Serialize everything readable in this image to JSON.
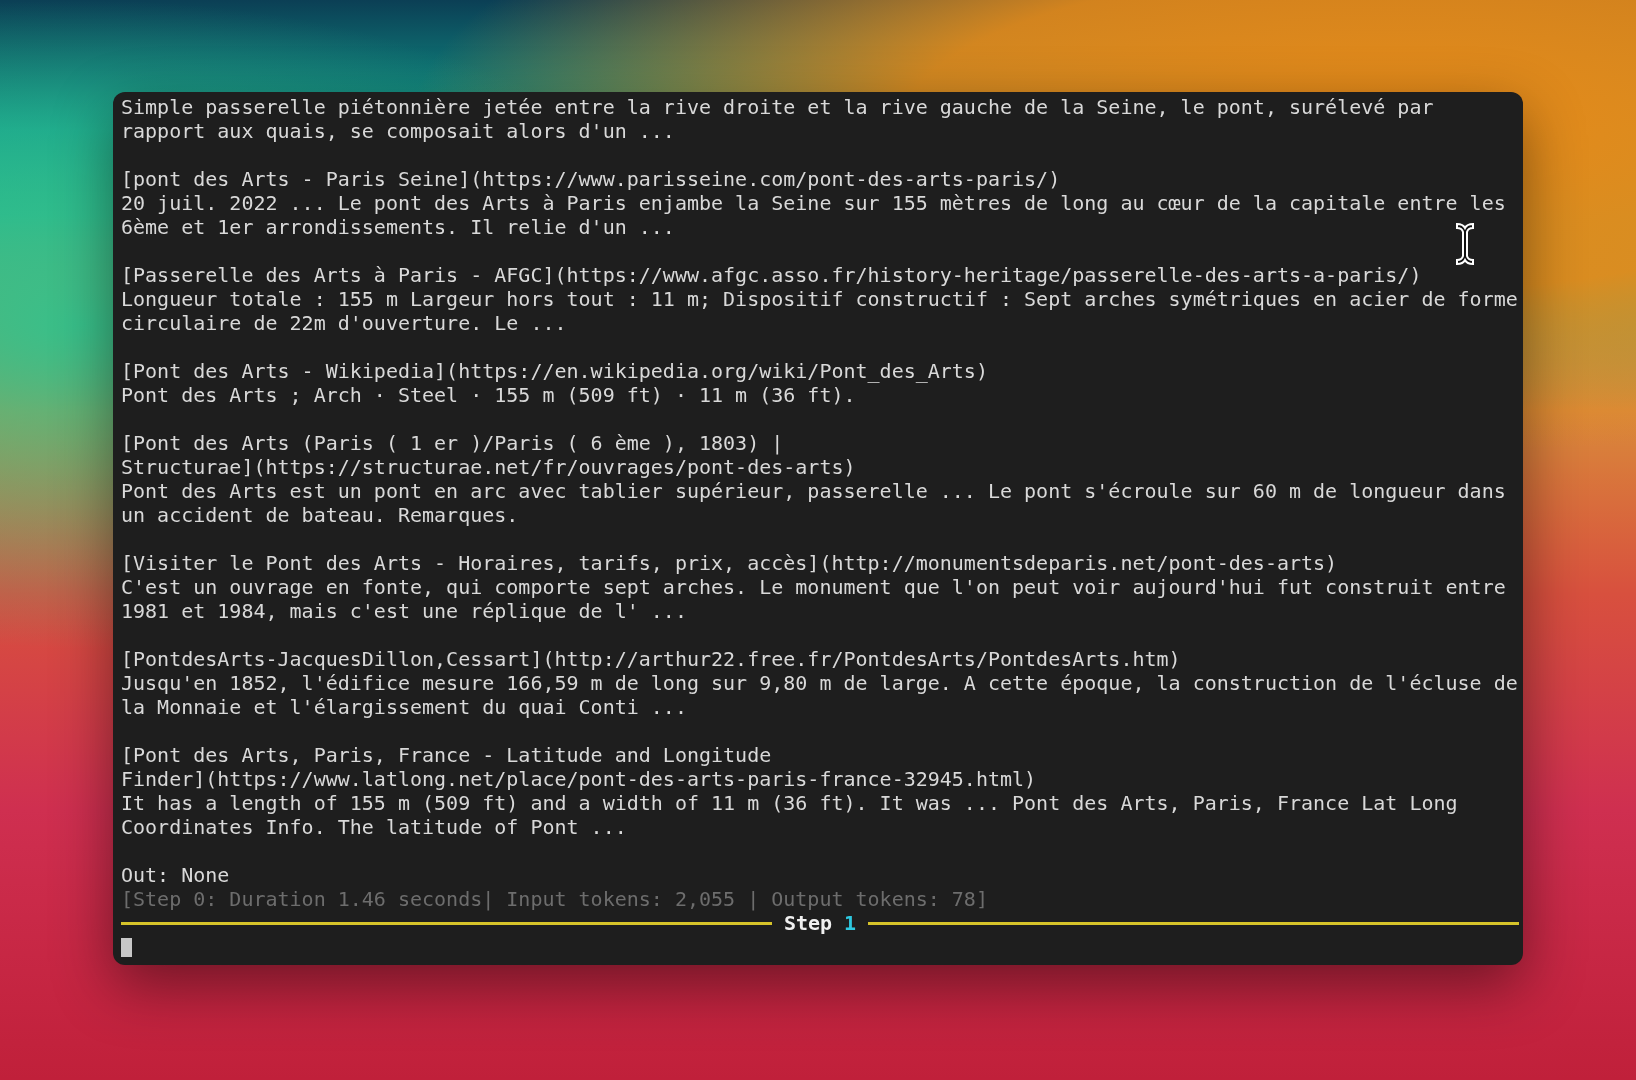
{
  "terminal": {
    "lines": [
      {
        "kind": "text",
        "text": "Simple passerelle piétonnière jetée entre la rive droite et la rive gauche de la Seine, le pont, surélevé par"
      },
      {
        "kind": "text",
        "text": "rapport aux quais, se composait alors d'un ..."
      },
      {
        "kind": "blank"
      },
      {
        "kind": "text",
        "text": "[pont des Arts - Paris Seine](https://www.parisseine.com/pont-des-arts-paris/)"
      },
      {
        "kind": "text",
        "text": "20 juil. 2022 ... Le pont des Arts à Paris enjambe la Seine sur 155 mètres de long au cœur de la capitale entre les"
      },
      {
        "kind": "text",
        "text": "6ème et 1er arrondissements. Il relie d'un ..."
      },
      {
        "kind": "blank"
      },
      {
        "kind": "text",
        "text": "[Passerelle des Arts à Paris - AFGC](https://www.afgc.asso.fr/history-heritage/passerelle-des-arts-a-paris/)"
      },
      {
        "kind": "text",
        "text": "Longueur totale : 155 m Largeur hors tout : 11 m; Dispositif constructif : Sept arches symétriques en acier de forme"
      },
      {
        "kind": "text",
        "text": "circulaire de 22m d'ouverture. Le ..."
      },
      {
        "kind": "blank"
      },
      {
        "kind": "text",
        "text": "[Pont des Arts - Wikipedia](https://en.wikipedia.org/wiki/Pont_des_Arts)"
      },
      {
        "kind": "text",
        "text": "Pont des Arts ; Arch · Steel · 155 m (509 ft) · 11 m (36 ft)."
      },
      {
        "kind": "blank"
      },
      {
        "kind": "text",
        "text": "[Pont des Arts (Paris ( 1 er )/Paris ( 6 ème ), 1803) |"
      },
      {
        "kind": "text",
        "text": "Structurae](https://structurae.net/fr/ouvrages/pont-des-arts)"
      },
      {
        "kind": "text",
        "text": "Pont des Arts est un pont en arc avec tablier supérieur, passerelle ... Le pont s'écroule sur 60 m de longueur dans"
      },
      {
        "kind": "text",
        "text": "un accident de bateau. Remarques."
      },
      {
        "kind": "blank"
      },
      {
        "kind": "text",
        "text": "[Visiter le Pont des Arts - Horaires, tarifs, prix, accès](http://monumentsdeparis.net/pont-des-arts)"
      },
      {
        "kind": "text",
        "text": "C'est un ouvrage en fonte, qui comporte sept arches. Le monument que l'on peut voir aujourd'hui fut construit entre"
      },
      {
        "kind": "text",
        "text": "1981 et 1984, mais c'est une réplique de l' ..."
      },
      {
        "kind": "blank"
      },
      {
        "kind": "text",
        "text": "[PontdesArts-JacquesDillon,Cessart](http://arthur22.free.fr/PontdesArts/PontdesArts.htm)"
      },
      {
        "kind": "text",
        "text": "Jusqu'en 1852, l'édifice mesure 166,59 m de long sur 9,80 m de large. A cette époque, la construction de l'écluse de"
      },
      {
        "kind": "text",
        "text": "la Monnaie et l'élargissement du quai Conti ..."
      },
      {
        "kind": "blank"
      },
      {
        "kind": "text",
        "text": "[Pont des Arts, Paris, France - Latitude and Longitude"
      },
      {
        "kind": "text",
        "text": "Finder](https://www.latlong.net/place/pont-des-arts-paris-france-32945.html)"
      },
      {
        "kind": "text",
        "text": "It has a length of 155 m (509 ft) and a width of 11 m (36 ft). It was ... Pont des Arts, Paris, France Lat Long"
      },
      {
        "kind": "text",
        "text": "Coordinates Info. The latitude of Pont ..."
      },
      {
        "kind": "blank"
      },
      {
        "kind": "text",
        "text": "Out: None"
      },
      {
        "kind": "dim",
        "text": "[Step 0: Duration 1.46 seconds| Input tokens: 2,055 | Output tokens: 78]"
      },
      {
        "kind": "rule",
        "label": "Step",
        "number": "1"
      },
      {
        "kind": "cursor"
      }
    ]
  }
}
